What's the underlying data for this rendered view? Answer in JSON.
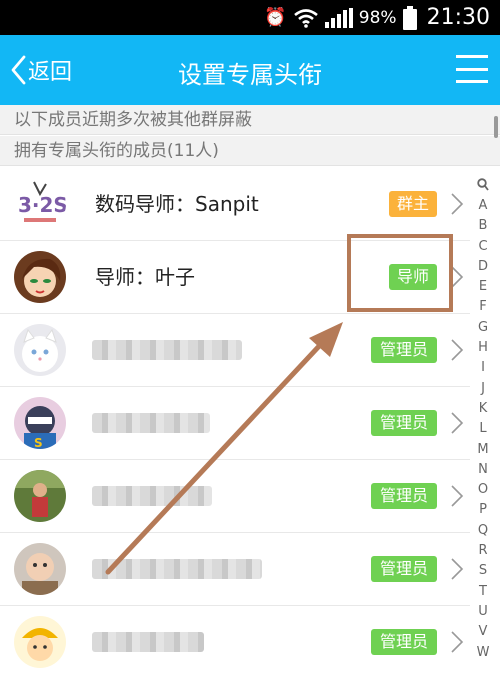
{
  "status_bar": {
    "battery": "98%",
    "time": "21:30"
  },
  "header": {
    "back_label": "返回",
    "title": "设置专属头衔"
  },
  "hints": {
    "blocked_notice": "以下成员近期多次被其他群屏蔽",
    "section_title": "拥有专属头衔的成员(11人)"
  },
  "members": [
    {
      "name": "数码导师：Sanpit",
      "title": "群主"
    },
    {
      "name": "导师：叶子",
      "title": "导师"
    },
    {
      "name": "",
      "title": "管理员"
    },
    {
      "name": "",
      "title": "管理员"
    },
    {
      "name": "",
      "title": "管理员"
    },
    {
      "name": "",
      "title": "管理员"
    },
    {
      "name": "",
      "title": "管理员"
    }
  ],
  "index_letters": [
    "A",
    "B",
    "C",
    "D",
    "E",
    "F",
    "G",
    "H",
    "I",
    "J",
    "K",
    "L",
    "M",
    "N",
    "O",
    "P",
    "Q",
    "R",
    "S",
    "T",
    "U",
    "V",
    "W"
  ],
  "colors": {
    "header": "#12b7f5",
    "owner_badge": "#fbb23b",
    "title_badge": "#6fd152",
    "annotation": "#b57a57"
  }
}
